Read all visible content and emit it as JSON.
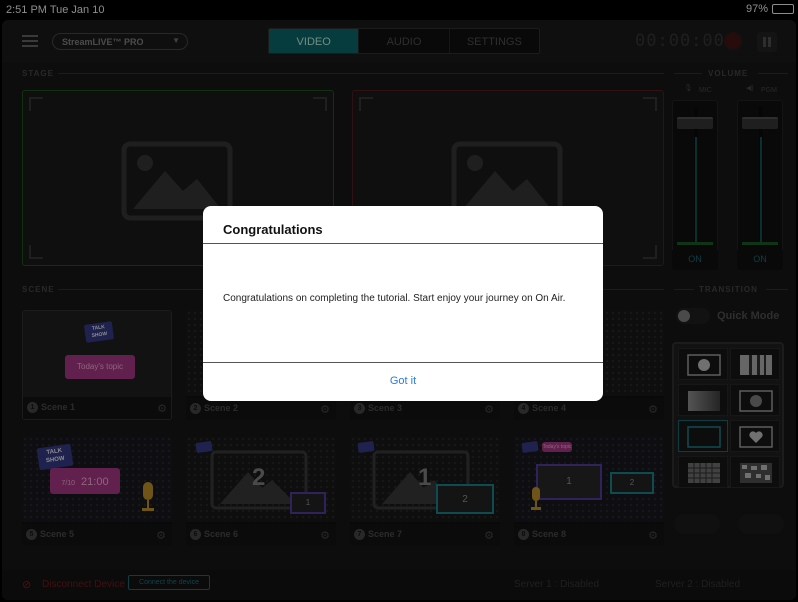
{
  "status_bar": {
    "time": "2:51 PM  Tue Jan 10",
    "battery": "97%"
  },
  "header": {
    "channel": "StreamLIVE™ PRO",
    "tabs": [
      {
        "label": "VIDEO",
        "active": true
      },
      {
        "label": "AUDIO",
        "active": false
      },
      {
        "label": "SETTINGS",
        "active": false
      }
    ],
    "timer": "00:00:00"
  },
  "stage": {
    "label": "STAGE"
  },
  "volume": {
    "label": "VOLUME",
    "mic_label": "MIC",
    "pgm_label": "PGM",
    "mic_on": "ON",
    "pgm_on": "ON",
    "meter_color": "#0c5e5c"
  },
  "scene_section": {
    "label": "SCENE"
  },
  "scenes": [
    {
      "num": "1",
      "name": "Scene 1",
      "topic": "Today's topic"
    },
    {
      "num": "2",
      "name": "Scene 2"
    },
    {
      "num": "3",
      "name": "Scene 3"
    },
    {
      "num": "4",
      "name": "Scene 4"
    },
    {
      "num": "5",
      "name": "Scene 5",
      "date": "7/10",
      "clock": "21:00"
    },
    {
      "num": "6",
      "name": "Scene 6",
      "big": "2",
      "small": "1"
    },
    {
      "num": "7",
      "name": "Scene 7",
      "big": "1",
      "small": "2"
    },
    {
      "num": "8",
      "name": "Scene 8",
      "topic": "Today's topic",
      "big": "1",
      "small": "2"
    }
  ],
  "flag_text": "TALK SHOW",
  "transition": {
    "label": "TRANSITION",
    "quick_mode": "Quick Mode"
  },
  "bottom": {
    "disconnect": "Disconnect Device",
    "connect_button": "Connect the device",
    "server1": "Server 1 :  Disabled",
    "server2": "Server 2 :  Disabled"
  },
  "dialog": {
    "title": "Congratulations",
    "message": "Congratulations on completing the tutorial. Start enjoy your journey on On Air.",
    "button": "Got it"
  },
  "colors": {
    "accent": "#0e6e73",
    "dialog_link": "#2a7be4"
  }
}
